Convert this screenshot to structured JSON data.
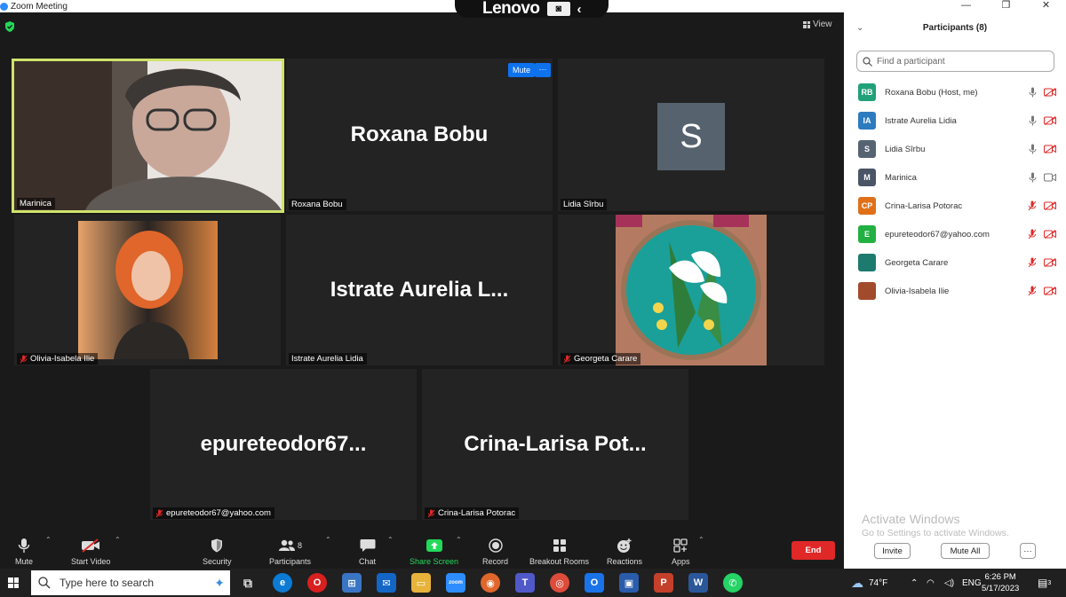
{
  "window": {
    "title": "Zoom Meeting",
    "laptop_brand": "Lenovo",
    "view_label": "View"
  },
  "tiles": {
    "marinica": {
      "name": "Marinica"
    },
    "roxana": {
      "big": "Roxana Bobu",
      "name": "Roxana Bobu",
      "mute_label": "Mute",
      "more_label": "···"
    },
    "lidia": {
      "initial": "S",
      "name": "Lidia Sîrbu"
    },
    "olivia": {
      "name": "Olivia-Isabela Ilie"
    },
    "istrate": {
      "big": "Istrate  Aurelia  L...",
      "name": "Istrate Aurelia Lidia"
    },
    "georgeta": {
      "name": "Georgeta Carare"
    },
    "epure": {
      "big": "epureteodor67...",
      "name": "epureteodor67@yahoo.com"
    },
    "crina": {
      "big": "Crina-Larisa  Pot...",
      "name": "Crina-Larisa Potorac"
    }
  },
  "toolbar": {
    "mute": "Mute",
    "start_video": "Start Video",
    "security": "Security",
    "participants": "Participants",
    "participants_count": "8",
    "chat": "Chat",
    "share_screen": "Share Screen",
    "record": "Record",
    "breakout_rooms": "Breakout Rooms",
    "reactions": "Reactions",
    "apps": "Apps",
    "end": "End"
  },
  "panel": {
    "title": "Participants (8)",
    "search_placeholder": "Find a participant",
    "participants": [
      {
        "initials": "RB",
        "name": "Roxana Bobu (Host, me)",
        "color": "#21a179",
        "mic": "on",
        "video": "off"
      },
      {
        "initials": "IA",
        "name": "Istrate Aurelia Lidia",
        "color": "#2d7bbf",
        "mic": "on",
        "video": "off"
      },
      {
        "initials": "S",
        "name": "Lidia Sîrbu",
        "color": "#566472",
        "mic": "on",
        "video": "off"
      },
      {
        "initials": "M",
        "name": "Marinica",
        "color": "#4a5566",
        "mic": "on",
        "video": "on"
      },
      {
        "initials": "CP",
        "name": "Crina-Larisa Potorac",
        "color": "#e07018",
        "mic": "off",
        "video": "off"
      },
      {
        "initials": "E",
        "name": "epureteodor67@yahoo.com",
        "color": "#23b043",
        "mic": "off",
        "video": "off"
      },
      {
        "initials": "",
        "name": "Georgeta Carare",
        "color": "#1d7a6e",
        "mic": "off",
        "video": "off"
      },
      {
        "initials": "",
        "name": "Olivia-Isabela Ilie",
        "color": "#a14a2c",
        "mic": "off",
        "video": "off"
      }
    ],
    "activate_title": "Activate Windows",
    "activate_sub": "Go to Settings to activate Windows.",
    "invite": "Invite",
    "mute_all": "Mute All",
    "more": "···"
  },
  "taskbar": {
    "search_placeholder": "Type here to search",
    "temperature": "74°F",
    "language": "ENG",
    "time": "6:26 PM",
    "date": "5/17/2023",
    "notifications": "3"
  }
}
